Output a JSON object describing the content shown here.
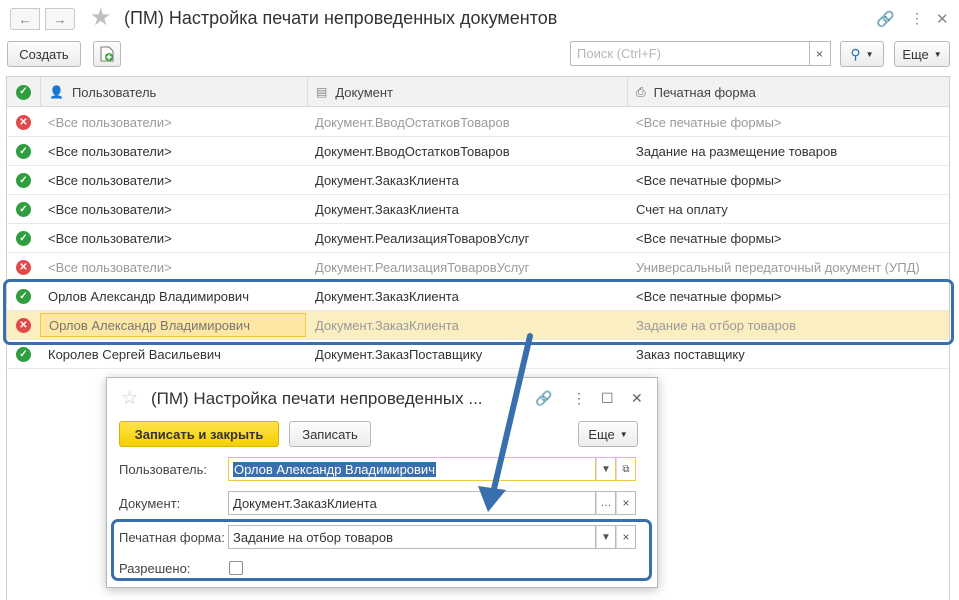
{
  "window": {
    "title": "(ПМ) Настройка печати непроведенных документов",
    "back_icon": "arrow-left-icon",
    "forward_icon": "arrow-right-icon"
  },
  "toolbar": {
    "create_label": "Создать",
    "search_placeholder": "Поиск (Ctrl+F)",
    "more_label": "Еще"
  },
  "table": {
    "headers": {
      "user": "Пользователь",
      "document": "Документ",
      "print_form": "Печатная форма"
    },
    "rows": [
      {
        "status": "✕",
        "user": "<Все пользователи>",
        "document": "Документ.ВводОстатковТоваров",
        "print_form": "<Все печатные формы>"
      },
      {
        "status": "✓",
        "user": "<Все пользователи>",
        "document": "Документ.ВводОстатковТоваров",
        "print_form": "Задание на размещение товаров"
      },
      {
        "status": "✓",
        "user": "<Все пользователи>",
        "document": "Документ.ЗаказКлиента",
        "print_form": "<Все печатные формы>"
      },
      {
        "status": "✓",
        "user": "<Все пользователи>",
        "document": "Документ.ЗаказКлиента",
        "print_form": "Счет на оплату"
      },
      {
        "status": "✓",
        "user": "<Все пользователи>",
        "document": "Документ.РеализацияТоваровУслуг",
        "print_form": "<Все печатные формы>"
      },
      {
        "status": "✕",
        "user": "<Все пользователи>",
        "document": "Документ.РеализацияТоваровУслуг",
        "print_form": "Универсальный передаточный документ (УПД)"
      },
      {
        "status": "✓",
        "user": "Орлов Александр Владимирович",
        "document": "Документ.ЗаказКлиента",
        "print_form": "<Все печатные формы>"
      },
      {
        "status": "✕",
        "user": "Орлов Александр Владимирович",
        "document": "Документ.ЗаказКлиента",
        "print_form": "Задание на отбор товаров"
      },
      {
        "status": "✓",
        "user": "Королев Сергей Васильевич",
        "document": "Документ.ЗаказПоставщику",
        "print_form": "Заказ поставщику"
      }
    ]
  },
  "dialog": {
    "title": "(ПМ) Настройка печати непроведенных ...",
    "save_close_label": "Записать и закрыть",
    "save_label": "Записать",
    "more_label": "Еще",
    "user_label": "Пользователь:",
    "user_value": "Орлов Александр Владимирович",
    "document_label": "Документ:",
    "document_value": "Документ.ЗаказКлиента",
    "print_form_label": "Печатная форма:",
    "print_form_value": "Задание на отбор товаров",
    "allowed_label": "Разрешено:",
    "allowed_checked": false
  },
  "colors": {
    "ok": "#2e9e3e",
    "error": "#e04a4a",
    "selection": "#fbeec0",
    "annotation": "#3a6fae",
    "primary_button": "#f6cf00"
  }
}
